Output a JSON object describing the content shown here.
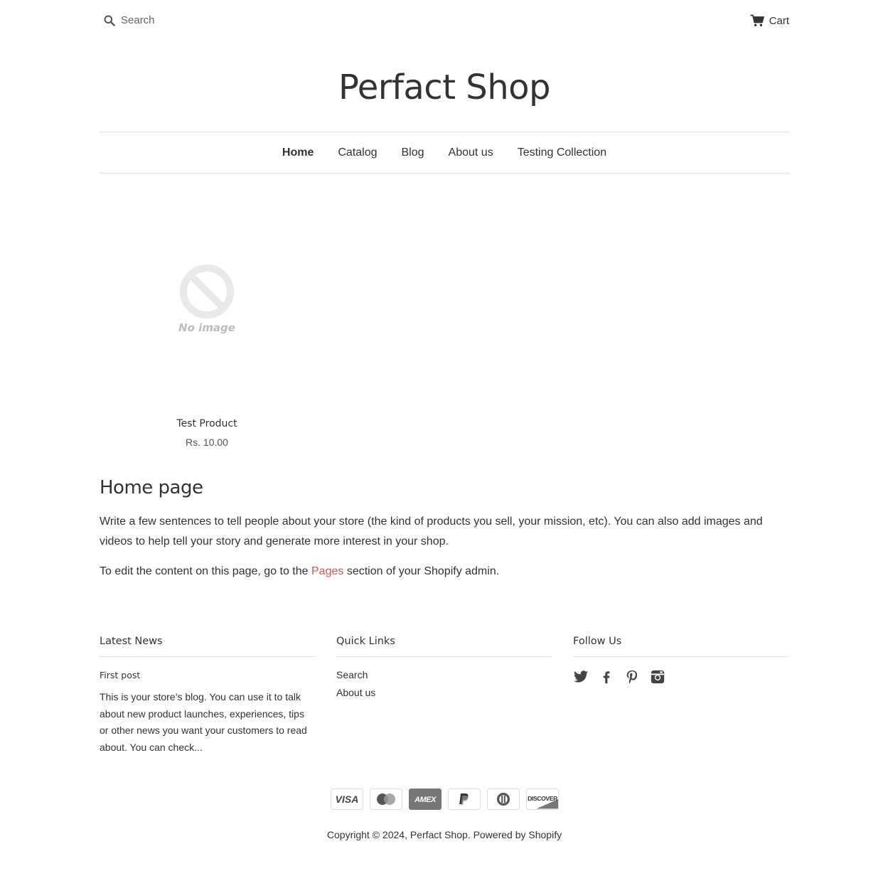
{
  "header": {
    "search_placeholder": "Search",
    "cart_label": "Cart",
    "shop_name": "Perfact Shop"
  },
  "nav": {
    "items": [
      {
        "label": "Home",
        "active": true
      },
      {
        "label": "Catalog"
      },
      {
        "label": "Blog"
      },
      {
        "label": "About us"
      },
      {
        "label": "Testing Collection"
      }
    ]
  },
  "product": {
    "image_text": "No image",
    "title": "Test Product",
    "price": "Rs. 10.00"
  },
  "content": {
    "title": "Home page",
    "paragraph1": "Write a few sentences to tell people about your store (the kind of products you sell, your mission, etc). You can also add images and videos to help tell your story and generate more interest in your shop.",
    "paragraph2_before": "To edit the content on this page, go to the ",
    "paragraph2_link": "Pages",
    "paragraph2_after": " section of your Shopify admin.",
    "link_color": "#d9534f"
  },
  "footer": {
    "latest_news": {
      "heading": "Latest News",
      "post_title": "First post",
      "post_excerpt": "This is your store’s blog. You can use it to talk about new product launches, experiences, tips or other news you want your customers to read about. You can check..."
    },
    "quick_links": {
      "heading": "Quick Links",
      "items": [
        "Search",
        "About us"
      ]
    },
    "follow_us": {
      "heading": "Follow Us",
      "icons": [
        "twitter-icon",
        "facebook-icon",
        "pinterest-icon",
        "instagram-icon"
      ]
    },
    "payments": {
      "visa": "VISA",
      "amex": "AMEX",
      "discover": "DISCOVER"
    },
    "copyright_prefix": "Copyright © 2024, ",
    "copyright_shop": "Perfact Shop",
    "copyright_sep": ". ",
    "powered_by": "Powered by Shopify"
  }
}
